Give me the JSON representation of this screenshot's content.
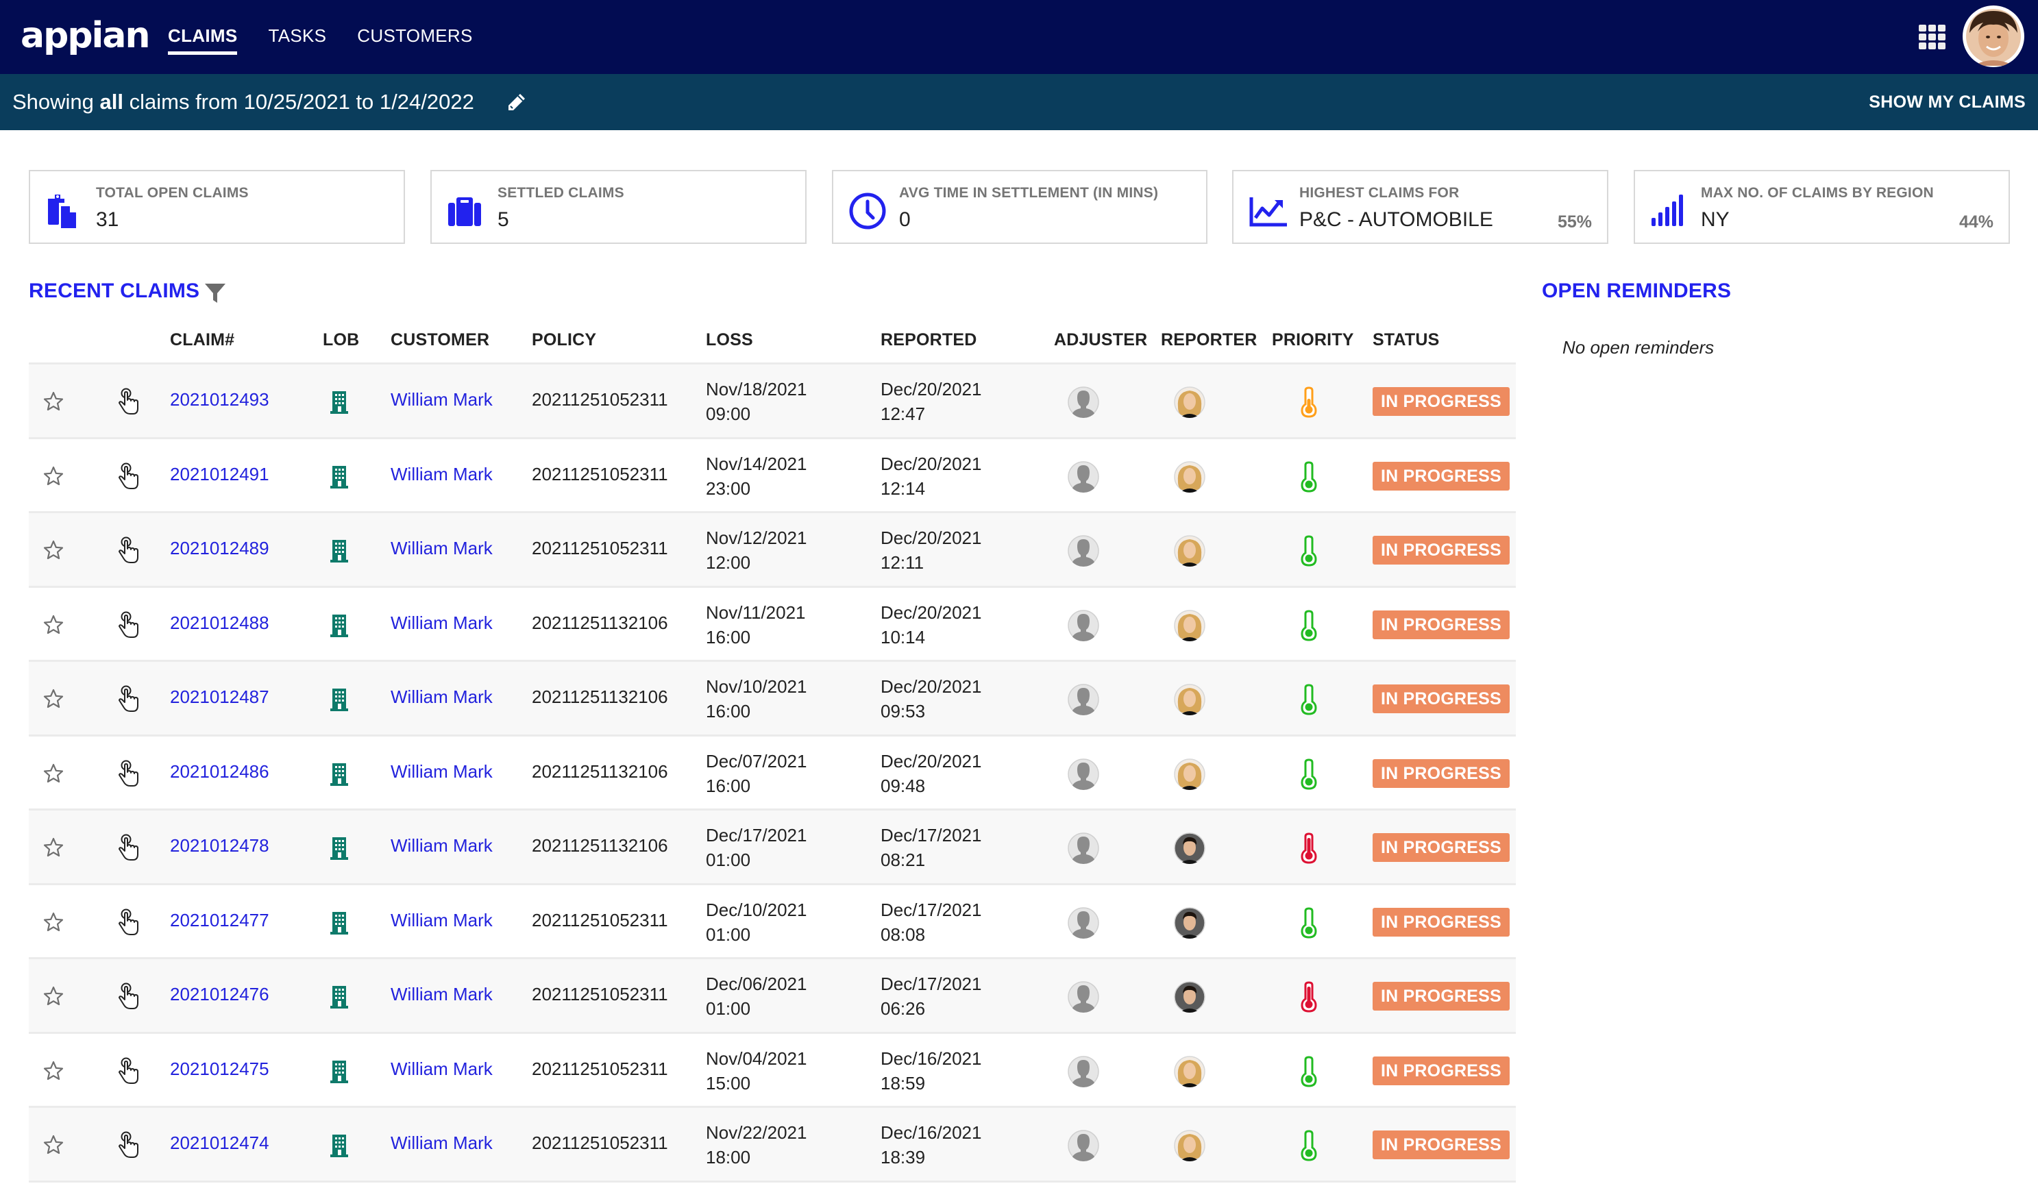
{
  "header": {
    "logo": "appian",
    "nav": [
      {
        "label": "CLAIMS",
        "active": true
      },
      {
        "label": "TASKS",
        "active": false
      },
      {
        "label": "CUSTOMERS",
        "active": false
      }
    ],
    "apps_icon": "grid-icon",
    "user_avatar": "user-avatar"
  },
  "subheader": {
    "prefix": "Showing ",
    "emphasis": "all",
    "suffix": " claims from 10/25/2021 to 1/24/2022",
    "edit_icon": "pencil-icon",
    "show_my_claims": "SHOW MY CLAIMS"
  },
  "kpis": [
    {
      "label": "TOTAL OPEN CLAIMS",
      "value": "31",
      "icon": "clipboard-icon",
      "percent": null
    },
    {
      "label": "SETTLED CLAIMS",
      "value": "5",
      "icon": "briefcase-icon",
      "percent": null
    },
    {
      "label": "AVG TIME IN SETTLEMENT (IN MINS)",
      "value": "0",
      "icon": "clock-icon",
      "percent": null
    },
    {
      "label": "HIGHEST CLAIMS FOR",
      "value": "P&C - AUTOMOBILE",
      "icon": "line-chart-icon",
      "percent": "55%"
    },
    {
      "label": "MAX NO. OF CLAIMS BY REGION",
      "value": "NY",
      "icon": "signal-bars-icon",
      "percent": "44%"
    }
  ],
  "colors": {
    "header_bg": "#020c52",
    "subheader_bg": "#0a3d5c",
    "accent": "#2222ee",
    "link": "#2222dd",
    "status_in_progress": "#ee8b5f",
    "priority_low": "#22bb22",
    "priority_medium": "#ff9f1a",
    "priority_high": "#dd1133",
    "lob_icon": "#0e7a6a"
  },
  "recent_claims": {
    "title": "RECENT CLAIMS",
    "filter_icon": "filter-icon",
    "columns": [
      "",
      "",
      "CLAIM#",
      "LOB",
      "CUSTOMER",
      "POLICY",
      "LOSS",
      "REPORTED",
      "ADJUSTER",
      "REPORTER",
      "PRIORITY",
      "STATUS"
    ],
    "rows": [
      {
        "claim": "2021012493",
        "customer": "William Mark",
        "policy": "20211251052311",
        "loss_date": "Nov/18/2021",
        "loss_time": "09:00",
        "reported_date": "Dec/20/2021",
        "reported_time": "12:47",
        "reporter": "female",
        "priority": "medium",
        "status": "IN PROGRESS"
      },
      {
        "claim": "2021012491",
        "customer": "William Mark",
        "policy": "20211251052311",
        "loss_date": "Nov/14/2021",
        "loss_time": "23:00",
        "reported_date": "Dec/20/2021",
        "reported_time": "12:14",
        "reporter": "female",
        "priority": "low",
        "status": "IN PROGRESS"
      },
      {
        "claim": "2021012489",
        "customer": "William Mark",
        "policy": "20211251052311",
        "loss_date": "Nov/12/2021",
        "loss_time": "12:00",
        "reported_date": "Dec/20/2021",
        "reported_time": "12:11",
        "reporter": "female",
        "priority": "low",
        "status": "IN PROGRESS"
      },
      {
        "claim": "2021012488",
        "customer": "William Mark",
        "policy": "20211251132106",
        "loss_date": "Nov/11/2021",
        "loss_time": "16:00",
        "reported_date": "Dec/20/2021",
        "reported_time": "10:14",
        "reporter": "female",
        "priority": "low",
        "status": "IN PROGRESS"
      },
      {
        "claim": "2021012487",
        "customer": "William Mark",
        "policy": "20211251132106",
        "loss_date": "Nov/10/2021",
        "loss_time": "16:00",
        "reported_date": "Dec/20/2021",
        "reported_time": "09:53",
        "reporter": "female",
        "priority": "low",
        "status": "IN PROGRESS"
      },
      {
        "claim": "2021012486",
        "customer": "William Mark",
        "policy": "20211251132106",
        "loss_date": "Dec/07/2021",
        "loss_time": "16:00",
        "reported_date": "Dec/20/2021",
        "reported_time": "09:48",
        "reporter": "female",
        "priority": "low",
        "status": "IN PROGRESS"
      },
      {
        "claim": "2021012478",
        "customer": "William Mark",
        "policy": "20211251132106",
        "loss_date": "Dec/17/2021",
        "loss_time": "01:00",
        "reported_date": "Dec/17/2021",
        "reported_time": "08:21",
        "reporter": "male",
        "priority": "high",
        "status": "IN PROGRESS"
      },
      {
        "claim": "2021012477",
        "customer": "William Mark",
        "policy": "20211251052311",
        "loss_date": "Dec/10/2021",
        "loss_time": "01:00",
        "reported_date": "Dec/17/2021",
        "reported_time": "08:08",
        "reporter": "male",
        "priority": "low",
        "status": "IN PROGRESS"
      },
      {
        "claim": "2021012476",
        "customer": "William Mark",
        "policy": "20211251052311",
        "loss_date": "Dec/06/2021",
        "loss_time": "01:00",
        "reported_date": "Dec/17/2021",
        "reported_time": "06:26",
        "reporter": "male",
        "priority": "high",
        "status": "IN PROGRESS"
      },
      {
        "claim": "2021012475",
        "customer": "William Mark",
        "policy": "20211251052311",
        "loss_date": "Nov/04/2021",
        "loss_time": "15:00",
        "reported_date": "Dec/16/2021",
        "reported_time": "18:59",
        "reporter": "female",
        "priority": "low",
        "status": "IN PROGRESS"
      },
      {
        "claim": "2021012474",
        "customer": "William Mark",
        "policy": "20211251052311",
        "loss_date": "Nov/22/2021",
        "loss_time": "18:00",
        "reported_date": "Dec/16/2021",
        "reported_time": "18:39",
        "reporter": "female",
        "priority": "low",
        "status": "IN PROGRESS"
      }
    ]
  },
  "open_reminders": {
    "title": "OPEN REMINDERS",
    "empty_text": "No open reminders"
  }
}
